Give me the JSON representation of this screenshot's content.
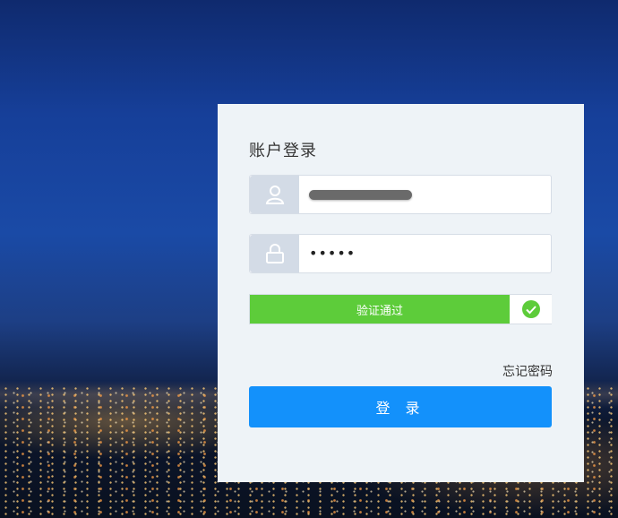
{
  "login": {
    "title": "账户登录",
    "username": {
      "value": "",
      "icon": "user-icon"
    },
    "password": {
      "value": "•••••",
      "icon": "lock-icon"
    },
    "verify": {
      "text": "验证通过",
      "icon": "check-circle-icon",
      "status_color": "#5dcc3a"
    },
    "forgot_password": "忘记密码",
    "login_button": "登 录",
    "accent": "#1391fb"
  }
}
